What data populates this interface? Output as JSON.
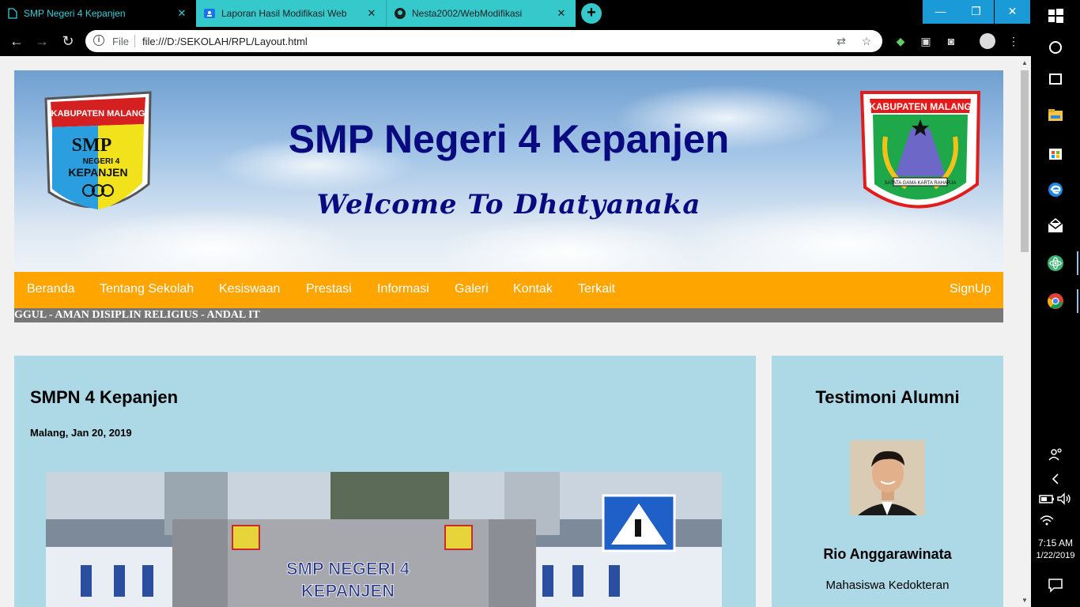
{
  "browser": {
    "tabs": [
      {
        "title": "SMP Negeri 4 Kepanjen",
        "icon": "document-icon",
        "active": true
      },
      {
        "title": "Laporan Hasil Modifikasi Web",
        "icon": "classroom-icon",
        "active": false
      },
      {
        "title": "Nesta2002/WebModifikasi",
        "icon": "github-icon",
        "active": false
      }
    ],
    "new_tab": "+",
    "omnibox": {
      "scheme_label": "File",
      "url": "file:///D:/SEKOLAH/RPL/Layout.html"
    },
    "window_controls": {
      "minimize": "—",
      "restore": "❐",
      "close": "✕"
    }
  },
  "page": {
    "header": {
      "title": "SMP Negeri 4 Kepanjen",
      "subtitle": "Welcome To Dhatyanaka",
      "logo_left": {
        "top_text": "KABUPATEN MALANG",
        "mid_text": "SMP NEGERI 4",
        "bottom_text": "KEPANJEN"
      },
      "logo_right": {
        "top_text": "KABUPATEN MALANG",
        "motto": "SATATA GAMA KARTA RAHARJA"
      }
    },
    "nav": {
      "items": [
        "Beranda",
        "Tentang Sekolah",
        "Kesiswaan",
        "Prestasi",
        "Informasi",
        "Galeri",
        "Kontak",
        "Terkait"
      ],
      "signup": "SignUp"
    },
    "marquee": "GGUL - AMAN DISIPLIN RELIGIUS - ANDAL IT",
    "post": {
      "title": "SMPN 4 Kepanjen",
      "date": "Malang, Jan 20, 2019",
      "image_text": [
        "SMP NEGERI 4",
        "KEPANJEN"
      ]
    },
    "sidebar": {
      "title": "Testimoni Alumni",
      "alumni_name": "Rio Anggarawinata",
      "alumni_role": "Mahasiswa Kedokteran"
    }
  },
  "taskbar": {
    "time": "7:15 AM",
    "date": "1/22/2019"
  },
  "colors": {
    "nav_bg": "#ffa500",
    "card_bg": "#add8e6",
    "title_color": "#0a0a80",
    "tab_accent": "#35c9cc"
  }
}
